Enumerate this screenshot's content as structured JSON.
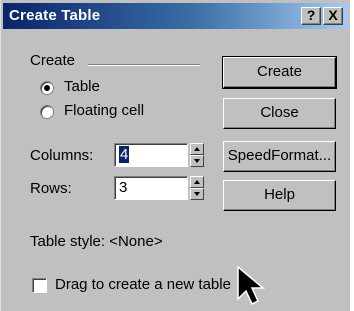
{
  "window": {
    "title": "Create Table",
    "help_glyph": "?",
    "close_glyph": "X"
  },
  "create_group": {
    "label": "Create",
    "options": [
      {
        "label": "Table",
        "selected": true
      },
      {
        "label": "Floating cell",
        "selected": false
      }
    ]
  },
  "columns": {
    "label": "Columns:",
    "value": "4"
  },
  "rows": {
    "label": "Rows:",
    "value": "3"
  },
  "table_style": {
    "text": "Table style: <None>"
  },
  "drag_option": {
    "label": "Drag to create a new table",
    "checked": false
  },
  "buttons": {
    "create": "Create",
    "close": "Close",
    "speedformat": "SpeedFormat...",
    "help": "Help"
  },
  "colors": {
    "face": "#c0c0c0",
    "titlebar_start": "#0a246a",
    "titlebar_end": "#a6caf0",
    "selection": "#0a246a"
  }
}
